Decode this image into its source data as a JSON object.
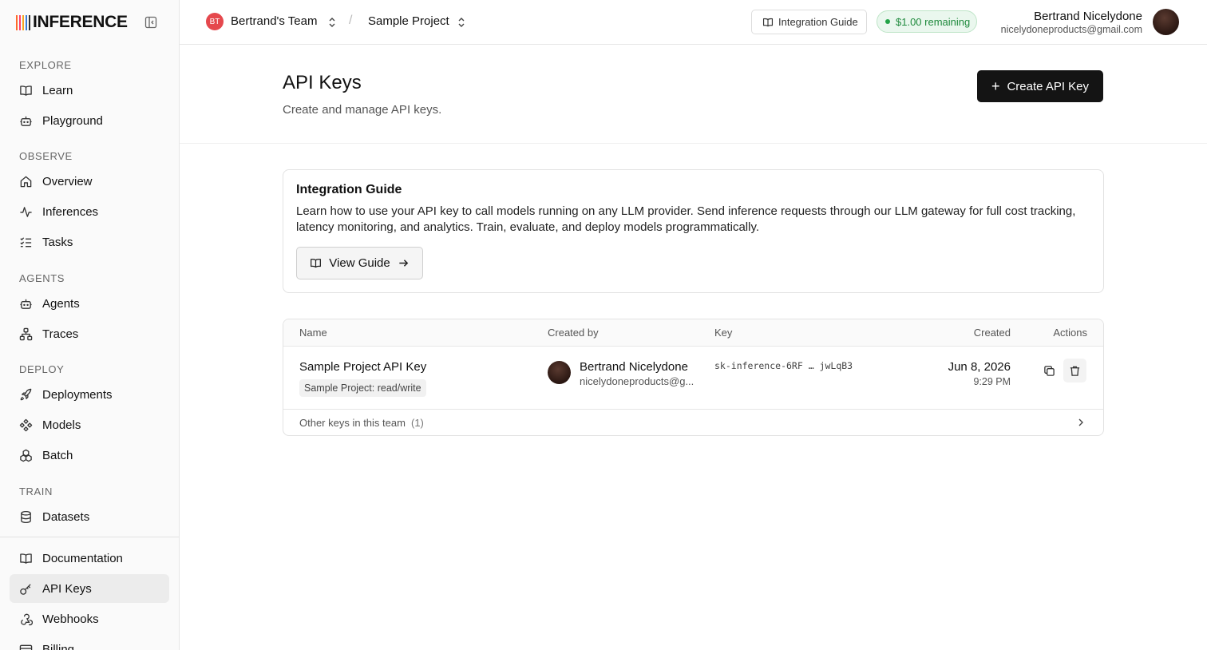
{
  "brand": {
    "logo_text": "INFERENCE",
    "bar_colors": [
      "#ff6a2a",
      "#ff3d6e",
      "#f5a623",
      "#3a7bd5",
      "#2d2d2d"
    ]
  },
  "sidebar": {
    "sections": {
      "explore": "EXPLORE",
      "observe": "OBSERVE",
      "agents": "AGENTS",
      "deploy": "DEPLOY",
      "train": "TRAIN"
    },
    "items": {
      "learn": "Learn",
      "playground": "Playground",
      "overview": "Overview",
      "inferences": "Inferences",
      "tasks": "Tasks",
      "agents": "Agents",
      "traces": "Traces",
      "deployments": "Deployments",
      "models": "Models",
      "batch": "Batch",
      "datasets": "Datasets",
      "documentation": "Documentation",
      "api_keys": "API Keys",
      "webhooks": "Webhooks",
      "billing": "Billing"
    },
    "active": "api_keys"
  },
  "header": {
    "team_initials": "BT",
    "team_name": "Bertrand's Team",
    "separator": "/",
    "project_name": "Sample Project",
    "integration_guide_label": "Integration Guide",
    "credit_label": "$1.00 remaining",
    "user_name": "Bertrand Nicelydone",
    "user_email": "nicelydoneproducts@gmail.com"
  },
  "page": {
    "title": "API Keys",
    "subtitle": "Create and manage API keys.",
    "create_button": "Create API Key"
  },
  "integration": {
    "title": "Integration Guide",
    "description": "Learn how to use your API key to call models running on any LLM provider. Send inference requests through our LLM gateway for full cost tracking, latency monitoring, and analytics. Train, evaluate, and deploy models programmatically.",
    "button": "View Guide"
  },
  "table": {
    "columns": {
      "name": "Name",
      "created_by": "Created by",
      "key": "Key",
      "created": "Created",
      "actions": "Actions"
    },
    "rows": [
      {
        "name": "Sample Project API Key",
        "scope": "Sample Project: read/write",
        "creator_name": "Bertrand Nicelydone",
        "creator_email": "nicelydoneproducts@g...",
        "key": "sk-inference-6RF … jwLqB3",
        "created_date": "Jun 8, 2026",
        "created_time": "9:29 PM"
      }
    ],
    "footer_label": "Other keys in this team",
    "footer_count": "(1)"
  }
}
